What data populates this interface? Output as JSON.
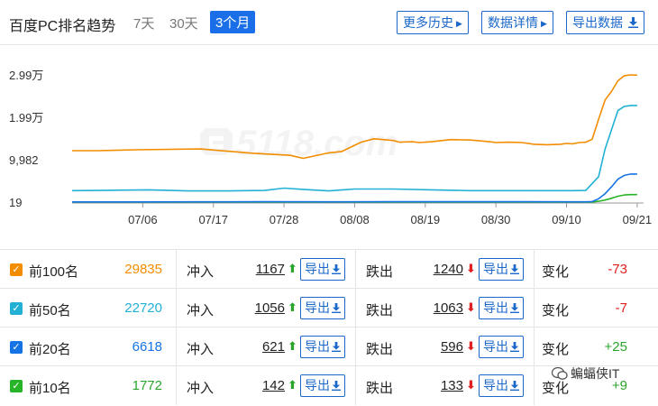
{
  "header": {
    "title": "百度PC排名趋势",
    "ranges": [
      "7天",
      "30天",
      "3个月"
    ],
    "active_range": "3个月",
    "buttons": {
      "history": "更多历史",
      "detail": "数据详情",
      "export": "导出数据"
    },
    "history_icon": "triangle-right-icon",
    "detail_icon": "triangle-right-icon",
    "export_icon": "download-icon"
  },
  "chart_data": {
    "type": "line",
    "title": "",
    "xlabel": "",
    "ylabel": "",
    "yticks": [
      19,
      9982,
      19900,
      29900
    ],
    "ytick_labels": [
      "19",
      "9,982",
      "1.99万",
      "2.99万"
    ],
    "ylim": [
      19,
      29900
    ],
    "xticks": [
      "07/06",
      "07/17",
      "07/28",
      "08/08",
      "08/19",
      "08/30",
      "09/10",
      "09/21"
    ],
    "xtick_days": [
      11,
      22,
      33,
      44,
      55,
      66,
      77,
      88
    ],
    "xlim": [
      0,
      89
    ],
    "grid": false,
    "watermark": "5118.com",
    "series": [
      {
        "color": "#f28d00",
        "x": [
          0,
          4,
          10,
          20,
          28,
          34,
          36,
          40,
          42,
          45,
          47,
          50,
          51,
          53,
          54,
          56,
          59,
          62,
          65,
          66,
          68,
          70,
          72,
          74,
          76,
          77,
          78,
          79,
          80,
          81,
          82,
          83,
          84,
          85,
          86,
          87,
          88
        ],
        "y": [
          12100,
          12100,
          12300,
          12500,
          11500,
          11000,
          10300,
          11600,
          11900,
          14100,
          14900,
          14500,
          14100,
          14200,
          14000,
          14200,
          14700,
          14600,
          14200,
          14000,
          14100,
          14000,
          13600,
          13500,
          13600,
          13800,
          13700,
          14000,
          14100,
          14800,
          19500,
          24000,
          26000,
          28500,
          29700,
          29900,
          29835
        ]
      },
      {
        "color": "#22b1d4",
        "x": [
          0,
          6,
          12,
          18,
          24,
          30,
          33,
          36,
          40,
          44,
          50,
          56,
          62,
          68,
          74,
          78,
          80,
          82,
          83,
          84,
          85,
          86,
          87,
          88
        ],
        "y": [
          2700,
          2800,
          2900,
          2650,
          2650,
          2750,
          3300,
          3000,
          2650,
          3100,
          3100,
          2900,
          2700,
          2700,
          2700,
          2700,
          2750,
          6000,
          12500,
          17000,
          21500,
          22500,
          22720,
          22720
        ]
      },
      {
        "color": "#1673e6",
        "x": [
          0,
          20,
          30,
          40,
          50,
          60,
          70,
          80,
          81,
          82,
          83,
          84,
          85,
          86,
          87,
          88
        ],
        "y": [
          60,
          80,
          100,
          90,
          100,
          110,
          100,
          80,
          150,
          800,
          2000,
          3600,
          5400,
          6300,
          6618,
          6618
        ]
      },
      {
        "color": "#28b428",
        "x": [
          0,
          20,
          30,
          40,
          50,
          60,
          70,
          80,
          81,
          82,
          83,
          84,
          85,
          86,
          87,
          88
        ],
        "y": [
          19,
          30,
          40,
          35,
          40,
          45,
          40,
          25,
          50,
          200,
          500,
          900,
          1400,
          1700,
          1772,
          1772
        ]
      }
    ]
  },
  "rows": [
    {
      "label": "前100名",
      "total": "29835",
      "box_color": "#f28d00",
      "total_color": "#f28d00",
      "in_label": "冲入",
      "in": "1167",
      "out_label": "跌出",
      "out": "1240",
      "export_label": "导出",
      "change_label": "变化",
      "change": "-73",
      "change_color": "#e02020"
    },
    {
      "label": "前50名",
      "total": "22720",
      "box_color": "#22b1d4",
      "total_color": "#22b1d4",
      "in_label": "冲入",
      "in": "1056",
      "out_label": "跌出",
      "out": "1063",
      "export_label": "导出",
      "change_label": "变化",
      "change": "-7",
      "change_color": "#e02020"
    },
    {
      "label": "前20名",
      "total": "6618",
      "box_color": "#1673e6",
      "total_color": "#1673e6",
      "in_label": "冲入",
      "in": "621",
      "out_label": "跌出",
      "out": "596",
      "export_label": "导出",
      "change_label": "变化",
      "change": "+25",
      "change_color": "#2aa52a"
    },
    {
      "label": "前10名",
      "total": "1772",
      "box_color": "#28b428",
      "total_color": "#2aa52a",
      "in_label": "冲入",
      "in": "142",
      "out_label": "跌出",
      "out": "133",
      "export_label": "导出",
      "change_label": "变化",
      "change": "+9",
      "change_color": "#2aa52a"
    }
  ],
  "icons": {
    "in_arrow": "arrow-up-icon",
    "out_arrow": "arrow-down-icon",
    "in_arrow_color": "#2aa52a",
    "out_arrow_color": "#e02020"
  },
  "watermark_account": "蝙蝠侠IT"
}
